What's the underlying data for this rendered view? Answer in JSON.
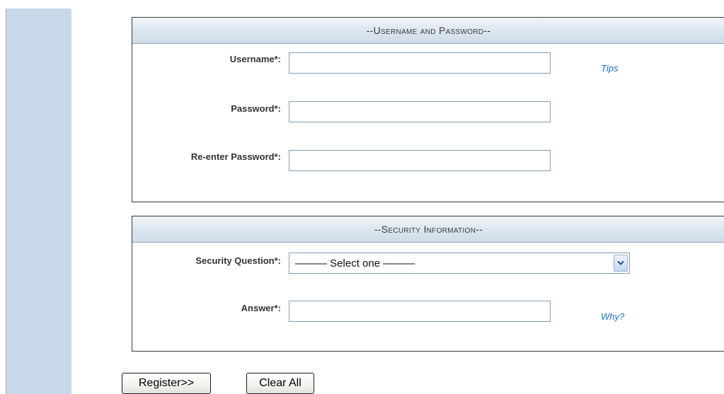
{
  "sections": {
    "credentials": {
      "title": "--Username and Password--",
      "username_label": "Username*:",
      "username_value": "",
      "tips_link": "Tips",
      "password_label": "Password*:",
      "password_value": "",
      "reenter_label": "Re-enter Password*:",
      "reenter_value": ""
    },
    "security": {
      "title": "--Security Information--",
      "question_label": "Security Question*:",
      "question_selected": "——— Select one ———",
      "answer_label": "Answer*:",
      "answer_value": "",
      "why_link": "Why?"
    }
  },
  "buttons": {
    "register": "Register>>",
    "clear": "Clear All"
  },
  "colors": {
    "sidebar": "#c9d8e8",
    "header": "#dbe5ef",
    "link": "#1a6fc9",
    "input_border": "#7f9db9"
  },
  "icons": {
    "dropdown": "chevron-down-icon"
  }
}
